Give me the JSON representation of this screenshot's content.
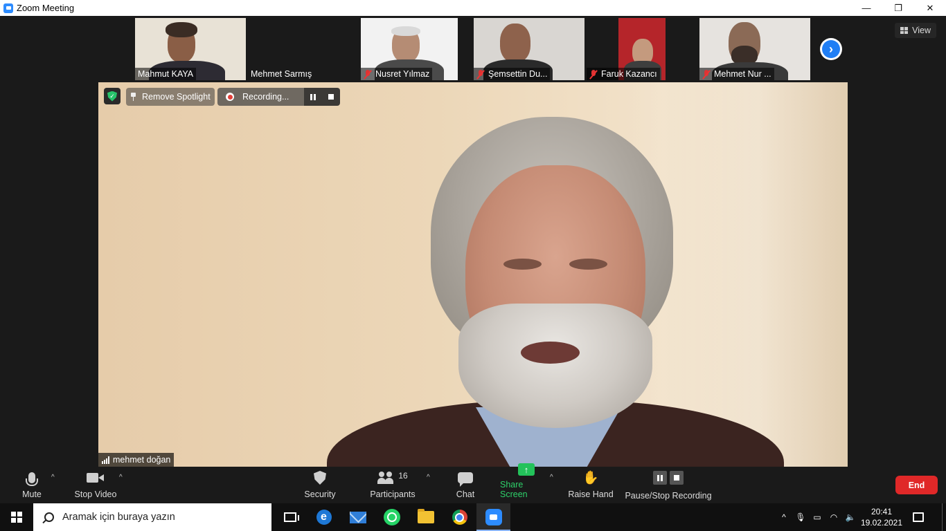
{
  "window": {
    "title": "Zoom Meeting",
    "minimize": "—",
    "restore": "❐",
    "close": "✕"
  },
  "view_button": {
    "label": "View"
  },
  "thumbnails": [
    {
      "name": "Mahmut KAYA",
      "muted": false
    },
    {
      "name": "Mehmet Sarmış",
      "muted": false
    },
    {
      "name": "Nusret Yılmaz",
      "muted": true
    },
    {
      "name": "Şemsettin Du...",
      "muted": true
    },
    {
      "name": "Faruk Kazancı",
      "muted": true
    },
    {
      "name": "Mehmet Nur ...",
      "muted": true
    }
  ],
  "next_page": {
    "glyph": "›"
  },
  "main_video": {
    "shield_glyph": "✓",
    "remove_spotlight": "Remove Spotlight",
    "recording_label": "Recording...",
    "speaker_name": "mehmet doğan"
  },
  "toolbar": {
    "mute": "Mute",
    "stop_video": "Stop Video",
    "security": "Security",
    "participants": "Participants",
    "participants_count": "16",
    "chat": "Chat",
    "share_screen": "Share Screen",
    "share_glyph": "↑",
    "raise_hand": "Raise Hand",
    "hand_glyph": "✋",
    "pause_stop_recording": "Pause/Stop Recording",
    "end": "End",
    "caret": "^"
  },
  "taskbar": {
    "search_placeholder": "Aramak için buraya yazın",
    "edge_glyph": "e",
    "time": "20:41",
    "date": "19.02.2021",
    "tray_up": "^",
    "tray_mic": "🎙",
    "tray_battery": "▭",
    "tray_wifi": "◠",
    "tray_volume": "🔈"
  },
  "colors": {
    "accent": "#2d8cff",
    "end_red": "#e02828",
    "share_green": "#23c25a",
    "recording_red": "#e2403a"
  }
}
